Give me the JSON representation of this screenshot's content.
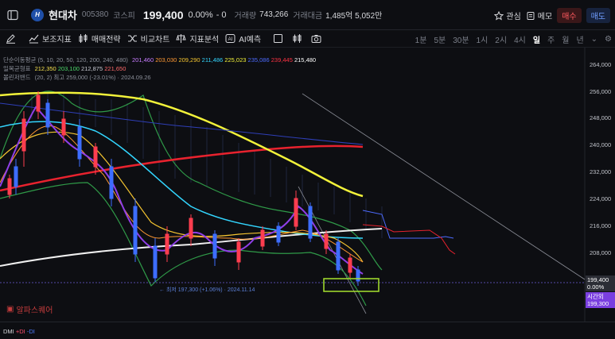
{
  "header": {
    "stock_name": "현대차",
    "stock_code": "005380",
    "market": "코스피",
    "price": "199,400",
    "change_pct": "0.00%",
    "change_val": "- 0",
    "volume_label": "거래량",
    "volume": "743,266",
    "amount_label": "거래대금",
    "amount": "1,485억 5,052만",
    "watch_label": "관심",
    "memo_label": "메모",
    "buy_label": "매수",
    "sell_label": "매도",
    "logo_text": "H"
  },
  "toolbar": {
    "indicator_label": "보조지표",
    "strategy_label": "매매전략",
    "compare_label": "비교차트",
    "analysis_label": "지표분석",
    "ai_label": "AI예측",
    "periods": [
      "1분",
      "5분",
      "30분",
      "1시",
      "2시",
      "4시",
      "일",
      "주",
      "월",
      "년"
    ],
    "active_period": "일"
  },
  "legend": {
    "ma_label": "단순이동평균 (5, 10, 20, 50, 120, 200, 240, 480)",
    "ma_values": [
      "201,460",
      "203,030",
      "209,290",
      "211,486",
      "225,023",
      "235,086",
      "239,445",
      "215,480"
    ],
    "ma_colors": [
      "#c77dff",
      "#ff9933",
      "#f4c430",
      "#33d6ff",
      "#f2f23a",
      "#4d6bff",
      "#ff3344",
      "#ffffff"
    ],
    "ichimoku_label": "일목균형표",
    "ichimoku_values": [
      "212,350",
      "203,100",
      "212,875",
      "221,650"
    ],
    "ichimoku_colors": [
      "#f4e04d",
      "#4dd96b",
      "#c7c9d1",
      "#ff6b6b"
    ],
    "bollinger_label": "볼린저밴드",
    "bollinger_text": "(20, 2) 최고 259,000 (-23.01%) · 2024.09.26"
  },
  "price_axis": {
    "ticks": [
      "264,000",
      "256,000",
      "248,000",
      "240,000",
      "232,000",
      "224,000",
      "216,000",
      "208,000"
    ],
    "current_price": "199,400",
    "current_pct": "0.00%",
    "open_label": "시간외",
    "open_price": "199,300"
  },
  "annotation": {
    "low_text": "최저 197,300 (+1.06%) · 2024.11.14"
  },
  "brand": {
    "name": "알파스퀘어"
  },
  "dmi": {
    "label": "DMI",
    "plus": "+DI",
    "minus": "-DI"
  },
  "colors": {
    "background": "#0d0e12",
    "up": "#ff3d4f",
    "down": "#3d6dff",
    "highlight_box": "#a6e22e"
  }
}
